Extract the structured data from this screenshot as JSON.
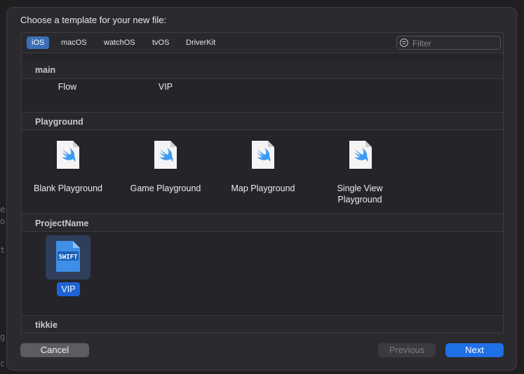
{
  "dialog": {
    "title": "Choose a template for your new file:"
  },
  "platform_tabs": [
    {
      "label": "iOS",
      "selected": true
    },
    {
      "label": "macOS",
      "selected": false
    },
    {
      "label": "watchOS",
      "selected": false
    },
    {
      "label": "tvOS",
      "selected": false
    },
    {
      "label": "DriverKit",
      "selected": false
    }
  ],
  "filter": {
    "placeholder": "Filter"
  },
  "sections": {
    "main": {
      "title": "main",
      "items": [
        {
          "label": "Flow"
        },
        {
          "label": "VIP"
        }
      ]
    },
    "playground": {
      "title": "Playground",
      "items": [
        {
          "label": "Blank Playground",
          "icon": "swift-file-icon"
        },
        {
          "label": "Game Playground",
          "icon": "swift-file-icon"
        },
        {
          "label": "Map Playground",
          "icon": "swift-file-icon"
        },
        {
          "label_line1": "Single View",
          "label_line2": "Playground",
          "icon": "swift-file-icon"
        }
      ]
    },
    "projectname": {
      "title": "ProjectName",
      "items": [
        {
          "label": "VIP",
          "icon": "swift-source-file-icon",
          "icon_text": "SWIFT",
          "selected": true
        }
      ]
    },
    "tikkie": {
      "title": "tikkie"
    }
  },
  "buttons": {
    "cancel": "Cancel",
    "previous": "Previous",
    "next": "Next"
  },
  "colors": {
    "selection": "#1f63d6",
    "next_button": "#1f70e5",
    "sheet_bg": "#2b2a2e"
  }
}
